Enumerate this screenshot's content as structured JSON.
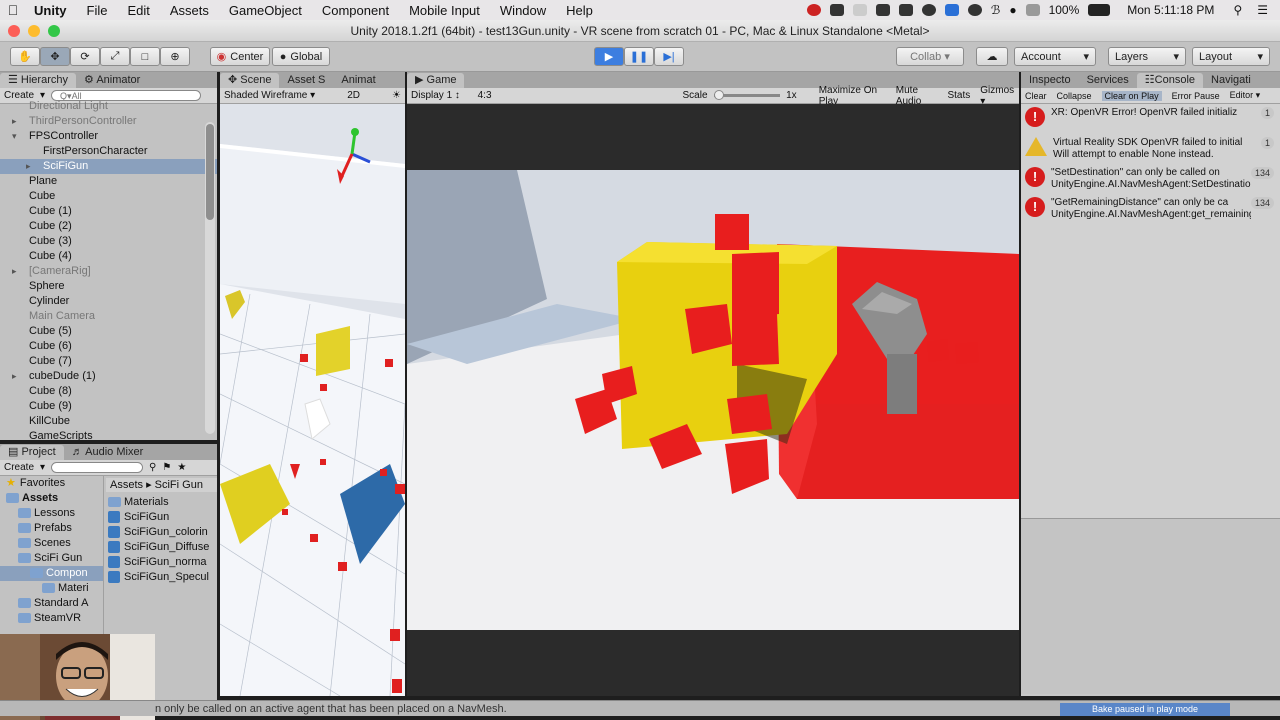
{
  "menubar": {
    "app": "Unity",
    "items": [
      "File",
      "Edit",
      "Assets",
      "GameObject",
      "Component",
      "Mobile Input",
      "Window",
      "Help"
    ],
    "battery": "100%",
    "clock": "Mon 5:11:18 PM"
  },
  "window": {
    "title": "Unity 2018.1.2f1 (64bit) - test13Gun.unity - VR scene from scratch 01 - PC, Mac & Linux Standalone <Metal>"
  },
  "toolbar": {
    "pivot": "Center",
    "space": "Global",
    "collab": "Collab",
    "account": "Account",
    "layers": "Layers",
    "layout": "Layout"
  },
  "hierarchy": {
    "tabs": [
      "Hierarchy",
      "Animator"
    ],
    "create": "Create",
    "search_placeholder": "Q▾All",
    "items": [
      {
        "label": "Directional Light",
        "indent": 0,
        "style": "gray"
      },
      {
        "label": "ThirdPersonController",
        "indent": 0,
        "style": "gray",
        "arrow": "▸"
      },
      {
        "label": "FPSController",
        "indent": 0,
        "style": "normal",
        "arrow": "▾"
      },
      {
        "label": "FirstPersonCharacter",
        "indent": 1,
        "style": "normal"
      },
      {
        "label": "SciFiGun",
        "indent": 1,
        "style": "sel",
        "arrow": "▸"
      },
      {
        "label": "Plane",
        "indent": 0,
        "style": "normal"
      },
      {
        "label": "Cube",
        "indent": 0,
        "style": "normal"
      },
      {
        "label": "Cube (1)",
        "indent": 0,
        "style": "normal"
      },
      {
        "label": "Cube (2)",
        "indent": 0,
        "style": "normal"
      },
      {
        "label": "Cube (3)",
        "indent": 0,
        "style": "normal"
      },
      {
        "label": "Cube (4)",
        "indent": 0,
        "style": "normal"
      },
      {
        "label": "[CameraRig]",
        "indent": 0,
        "style": "gray",
        "arrow": "▸"
      },
      {
        "label": "Sphere",
        "indent": 0,
        "style": "normal"
      },
      {
        "label": "Cylinder",
        "indent": 0,
        "style": "normal"
      },
      {
        "label": "Main Camera",
        "indent": 0,
        "style": "gray"
      },
      {
        "label": "Cube (5)",
        "indent": 0,
        "style": "normal"
      },
      {
        "label": "Cube (6)",
        "indent": 0,
        "style": "normal"
      },
      {
        "label": "Cube (7)",
        "indent": 0,
        "style": "normal"
      },
      {
        "label": "cubeDude (1)",
        "indent": 0,
        "style": "normal",
        "arrow": "▸"
      },
      {
        "label": "Cube (8)",
        "indent": 0,
        "style": "normal"
      },
      {
        "label": "Cube (9)",
        "indent": 0,
        "style": "normal"
      },
      {
        "label": "KillCube",
        "indent": 0,
        "style": "normal"
      },
      {
        "label": "GameScripts",
        "indent": 0,
        "style": "normal"
      }
    ]
  },
  "project": {
    "tabs": [
      "Project",
      "Audio Mixer"
    ],
    "create": "Create",
    "tree": [
      {
        "label": "Favorites",
        "type": "fav",
        "indent": 0
      },
      {
        "label": "Assets",
        "type": "folder",
        "indent": 0,
        "bold": true
      },
      {
        "label": "Lessons",
        "type": "folder",
        "indent": 1
      },
      {
        "label": "Prefabs",
        "type": "folder",
        "indent": 1
      },
      {
        "label": "Scenes",
        "type": "folder",
        "indent": 1
      },
      {
        "label": "SciFi Gun",
        "type": "folder",
        "indent": 1
      },
      {
        "label": "Compon",
        "type": "folder",
        "indent": 2,
        "sel": true
      },
      {
        "label": "Materi",
        "type": "folder",
        "indent": 3
      },
      {
        "label": "Standard A",
        "type": "folder",
        "indent": 1
      },
      {
        "label": "SteamVR",
        "type": "folder",
        "indent": 1
      }
    ],
    "breadcrumb": [
      "Assets",
      "SciFi Gun"
    ],
    "files": [
      "Materials",
      "SciFiGun",
      "SciFiGun_colorin",
      "SciFiGun_Diffuse",
      "SciFiGun_norma",
      "SciFiGun_Specul"
    ]
  },
  "scene": {
    "tabs": [
      "Scene",
      "Asset S",
      "Animat"
    ],
    "shading": "Shaded Wireframe",
    "mode2d": "2D"
  },
  "game": {
    "tab": "Game",
    "display": "Display 1",
    "aspect": "4:3",
    "scale_label": "Scale",
    "scale_value": "1x",
    "options": [
      "Maximize On Play",
      "Mute Audio",
      "Stats",
      "Gizmos"
    ]
  },
  "console": {
    "tabs": [
      "Inspecto",
      "Services",
      "Console",
      "Navigati"
    ],
    "buttons": [
      "Clear",
      "Collapse",
      "Clear on Play",
      "Error Pause",
      "Editor"
    ],
    "messages": [
      {
        "type": "error",
        "line1": "XR: OpenVR Error! OpenVR failed initializ",
        "line2": "",
        "count": "1"
      },
      {
        "type": "warning",
        "line1": "Virtual Reality SDK OpenVR failed to initial",
        "line2": "Will attempt to enable None instead.",
        "count": "1"
      },
      {
        "type": "error",
        "line1": "\"SetDestination\" can only be called on",
        "line2": "UnityEngine.AI.NavMeshAgent:SetDestination",
        "count": "134"
      },
      {
        "type": "error",
        "line1": "\"GetRemainingDistance\" can only be ca",
        "line2": "UnityEngine.AI.NavMeshAgent:get_remaining",
        "count": "134"
      }
    ]
  },
  "statusbar": {
    "message": "n only be called on an active agent that has been placed on a NavMesh.",
    "bake": "Bake paused in play mode"
  },
  "colors": {
    "play_active": "#3d7ee0",
    "error": "#d61d1d",
    "warning": "#e5b72a"
  }
}
